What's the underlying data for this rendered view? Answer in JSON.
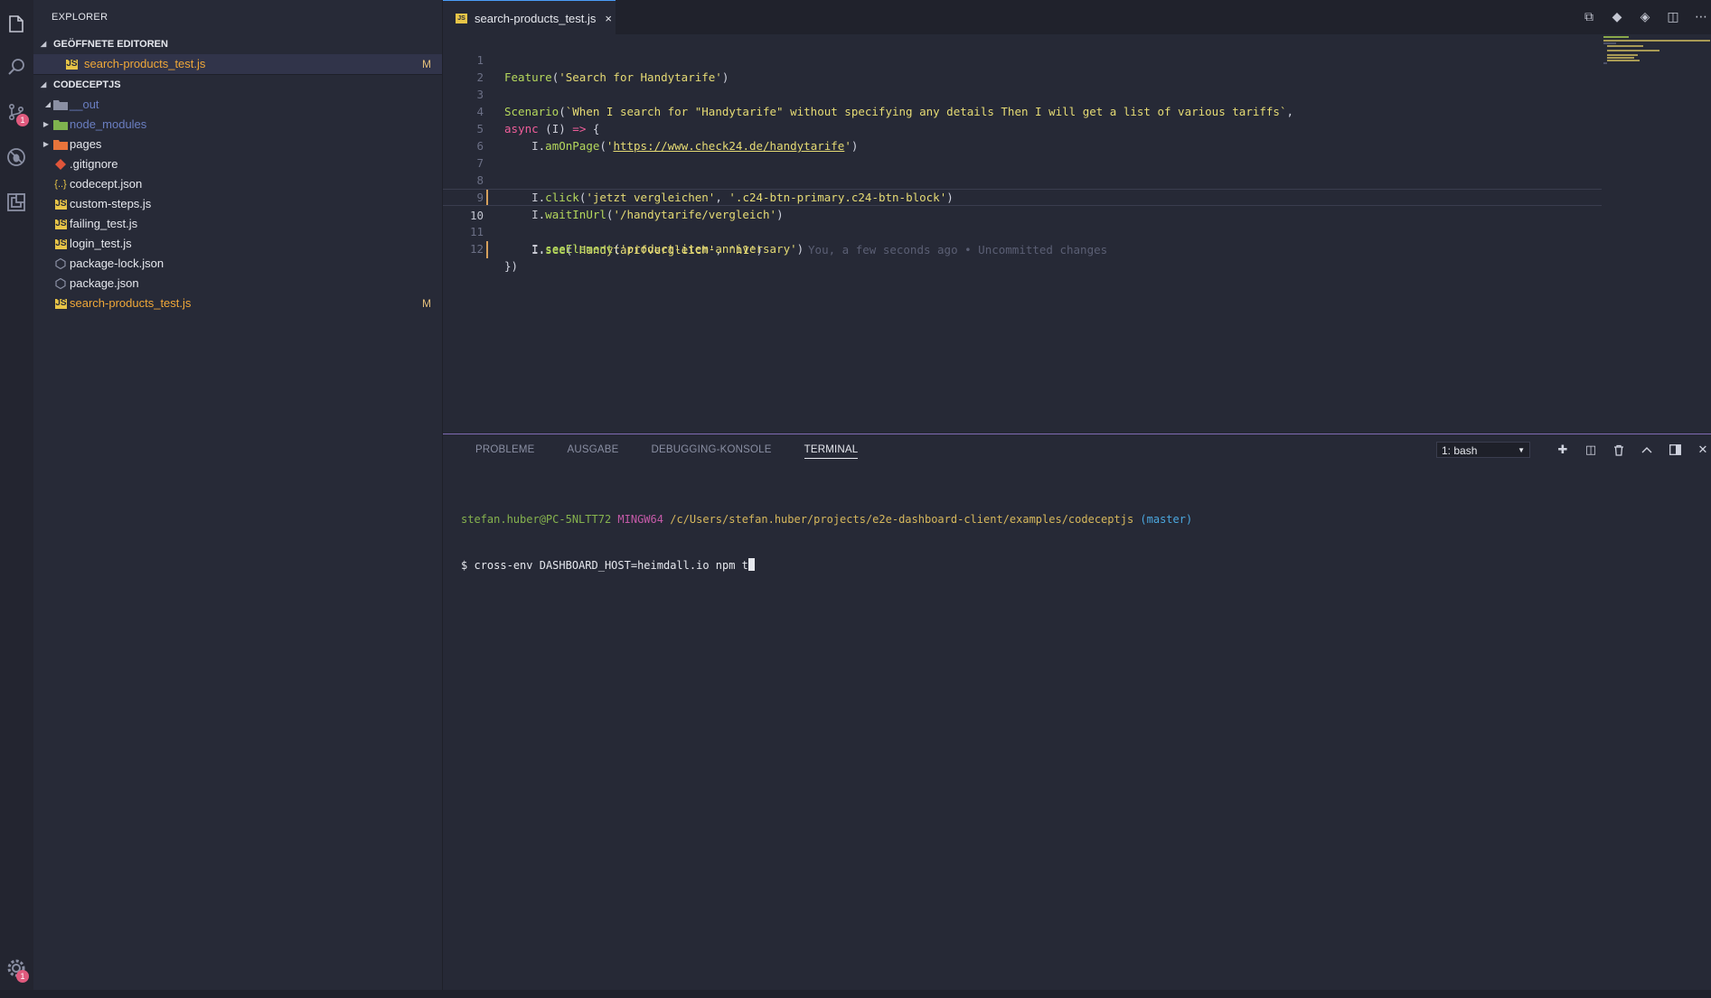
{
  "sidebar": {
    "title": "EXPLORER",
    "open_editors": {
      "header": "GEÖFFNETE EDITOREN",
      "items": [
        {
          "label": "search-products_test.js",
          "status": "M"
        }
      ]
    },
    "workspace": {
      "header": "CODECEPTJS",
      "items": [
        {
          "label": "__out",
          "icon": "folder-open-icon",
          "status": ""
        },
        {
          "label": "node_modules",
          "icon": "folder-node-icon",
          "status": ""
        },
        {
          "label": "pages",
          "icon": "folder-icon",
          "status": ""
        },
        {
          "label": ".gitignore",
          "icon": "git-icon",
          "status": ""
        },
        {
          "label": "codecept.json",
          "icon": "json-icon",
          "status": ""
        },
        {
          "label": "custom-steps.js",
          "icon": "js-file-icon",
          "status": ""
        },
        {
          "label": "failing_test.js",
          "icon": "js-file-icon",
          "status": ""
        },
        {
          "label": "login_test.js",
          "icon": "js-file-icon",
          "status": ""
        },
        {
          "label": "package-lock.json",
          "icon": "npm-icon",
          "status": ""
        },
        {
          "label": "package.json",
          "icon": "npm-icon",
          "status": ""
        },
        {
          "label": "search-products_test.js",
          "icon": "js-file-icon",
          "status": "M"
        }
      ]
    }
  },
  "activity_bar": {
    "scm_badge": "1",
    "settings_badge": "1"
  },
  "editor": {
    "tab_label": "search-products_test.js",
    "tab_icon": "JS",
    "close_glyph": "×",
    "blame_text": "You, a few seconds ago • Uncommitted changes",
    "line_numbers": [
      "1",
      "2",
      "3",
      "4",
      "5",
      "6",
      "7",
      "8",
      "9",
      "10",
      "11",
      "12"
    ],
    "lines": [
      "Feature('Search for Handytarife')",
      "",
      "Scenario(`When I search for \"Handytarife\" without specifying any details Then I will get a list of various tariffs`,",
      "async (I) => {",
      "    I.amOnPage('https://www.check24.de/handytarife')",
      "",
      "    I.click('jetzt vergleichen', '.c24-btn-primary.c24-btn-block')",
      "",
      "    I.waitInUrl('/handytarife/vergleich')",
      "    I.see('Handytarifvergleich', 'h1')",
      "    I.seeElement('product-item-anniversary')",
      "})"
    ]
  },
  "panel": {
    "tabs": [
      "PROBLEME",
      "AUSGABE",
      "DEBUGGING-KONSOLE",
      "TERMINAL"
    ],
    "active_tab": "TERMINAL",
    "terminal_select": "1: bash",
    "terminal": {
      "user": "stefan.huber@PC-5NLTT72",
      "env": "MINGW64",
      "path": "/c/Users/stefan.huber/projects/e2e-dashboard-client/examples/codeceptjs",
      "branch": "(master)",
      "prompt": "$",
      "command": "cross-env DASHBOARD_HOST=heimdall.io npm t"
    }
  },
  "colors": {
    "accent": "#4a9df8",
    "modified": "#f0a838",
    "panel_border": "#7f6bb3",
    "badge": "#e05a7e"
  }
}
